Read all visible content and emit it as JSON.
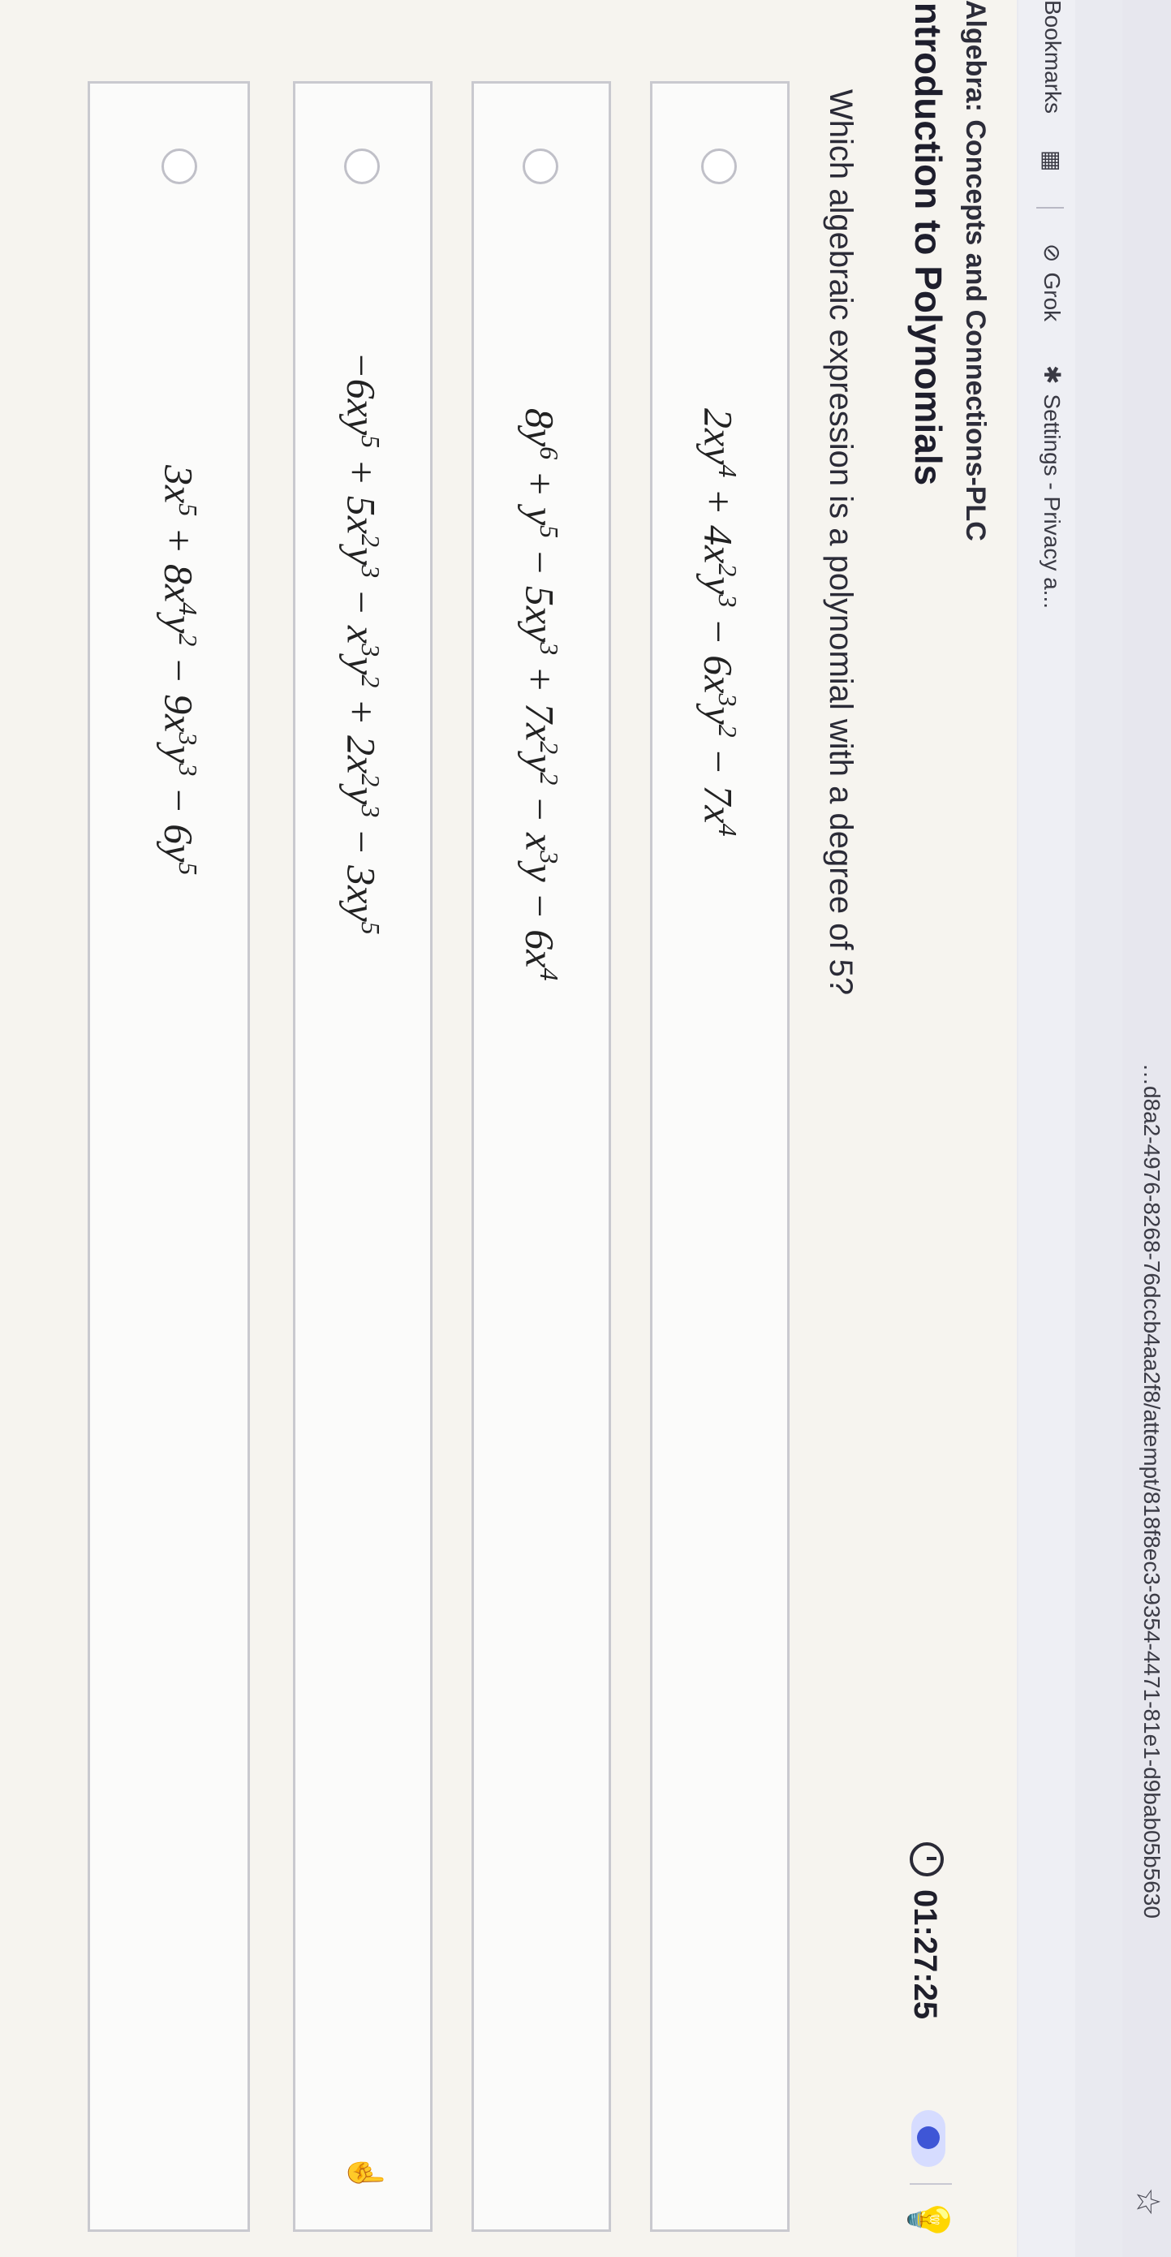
{
  "browser": {
    "url": "…d8a2-4976-8268-76dccb4aa2f8/attempt/818f8ec3-9354-4471-81e1-d9bab05b5630",
    "bookmarks": [
      {
        "label": "Bookmarks",
        "icon": "bookmarks-icon"
      },
      {
        "label": "Grok",
        "icon": "grok-icon"
      },
      {
        "label": "Settings - Privacy a...",
        "icon": "gear-icon"
      }
    ]
  },
  "header": {
    "course": "Algebra: Concepts and Connections-PLC",
    "lesson": "Introduction to Polynomials",
    "timer": "01:27:25"
  },
  "question": {
    "text": "Which algebraic expression is a polynomial with a degree of 5?"
  },
  "options": [
    {
      "terms": [
        "2xy",
        "4",
        " + 4x",
        "2",
        "y",
        "3",
        " − 6x",
        "3",
        "y",
        "2",
        " − 7x",
        "4"
      ]
    },
    {
      "terms": [
        "8y",
        "6",
        " + y",
        "5",
        " − 5xy",
        "3",
        " + 7x",
        "2",
        "y",
        "2",
        " − x",
        "3",
        "y − 6x",
        "4"
      ]
    },
    {
      "terms": [
        "−6xy",
        "5",
        " + 5x",
        "2",
        "y",
        "3",
        " − x",
        "3",
        "y",
        "2",
        " + 2x",
        "2",
        "y",
        "3",
        " − 3xy",
        "5"
      ]
    },
    {
      "terms": [
        "3x",
        "5",
        " + 8x",
        "4",
        "y",
        "2",
        " − 9x",
        "3",
        "y",
        "3",
        " − 6y",
        "5"
      ]
    }
  ]
}
